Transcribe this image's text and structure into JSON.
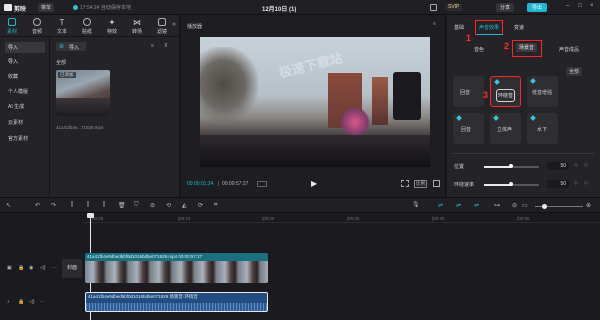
{
  "topbar": {
    "app": "剪映",
    "menu": "菜单",
    "save_status": "17:54:24 自动保存本地",
    "title": "12月10日 (1)",
    "pro": "SVIP",
    "share": "分享",
    "export": "导出"
  },
  "left": {
    "tabs": [
      "素材",
      "音频",
      "文本",
      "贴纸",
      "特效",
      "转场",
      "滤镜",
      "字幕"
    ],
    "menu": [
      "导入",
      "导入",
      "收藏",
      "个人模版",
      "AI 生成",
      "云素材",
      "官方素材"
    ],
    "import_btn": "导入",
    "all": "全部",
    "thumb_badge": "已添加",
    "thumb_time": "00:00:57:27",
    "thumb_name": "41a41fb4e...71929.mp4"
  },
  "player": {
    "title": "播放器",
    "time_current": "00:00:01:24",
    "time_total": "00:00:57:27",
    "ratio": "比例",
    "watermark": "极速下载站"
  },
  "right": {
    "tabs": [
      "基础",
      "声音效果",
      "变速"
    ],
    "subtabs": [
      "音色",
      "场景音",
      "声音成品"
    ],
    "filter": "全部",
    "cards": [
      "回音",
      "环绕音",
      "低音增强",
      "回音",
      "立体声",
      "水下"
    ],
    "pos_label": "位置",
    "pos_value": "50",
    "speed_label": "环绕速率",
    "speed_value": "50",
    "marks": [
      "1",
      "2",
      "3"
    ],
    "colors": {
      "accent": "#1fb7d2",
      "annotation": "#ff2424"
    }
  },
  "timeline": {
    "ruler": [
      "00:00",
      "|00:10",
      "|00:20",
      "|00:30",
      "|00:40",
      "|00:50"
    ],
    "cover": "封面",
    "video_clip_name": "41a41fb4e9dbed5bf0d1016bd5e071929.mp4  00:00:57:27",
    "audio_clip_name": "41a41fb4e9dbed5bf0d1016bd5e071929  场景音·环绕音"
  }
}
